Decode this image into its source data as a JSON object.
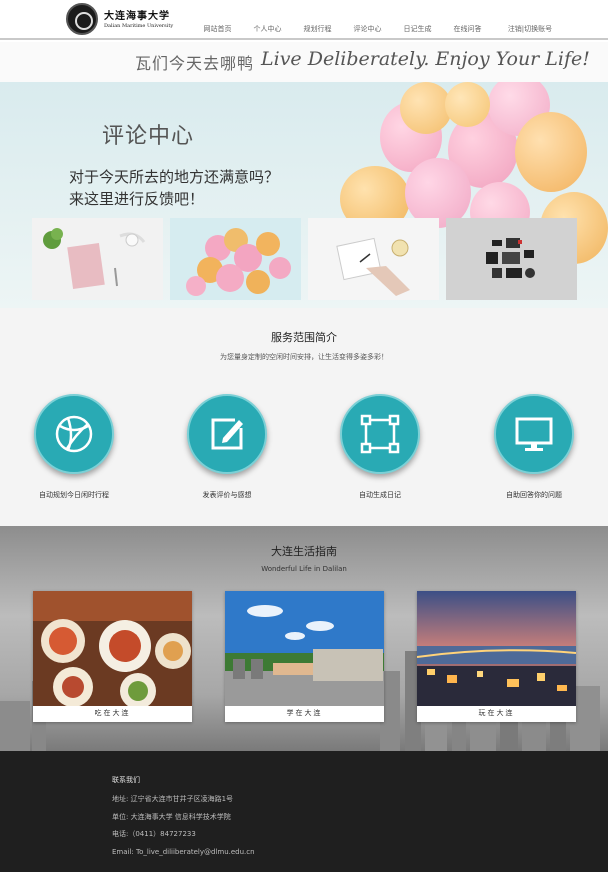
{
  "header": {
    "logo_cn": "大连海事大学",
    "logo_en": "Dalian Maritime University",
    "nav": [
      "网站首页",
      "个人中心",
      "规划行程",
      "评论中心",
      "日记生成",
      "在线问答",
      "注销|切换账号"
    ]
  },
  "slogan": {
    "cn": "瓦们今天去哪鸭",
    "en": "Live Deliberately. Enjoy Your Life!"
  },
  "hero": {
    "title": "评论中心",
    "subtitle_line1": "对于今天所去的地方还满意吗？",
    "subtitle_line2": "来这里进行反馈吧！"
  },
  "services": {
    "title": "服务范围简介",
    "subtitle": "为您量身定制的空闲时间安排，让生活变得多姿多彩！",
    "items": [
      {
        "label": "自动规划今日闲时行程",
        "icon": "basketball-icon"
      },
      {
        "label": "发表评价与感想",
        "icon": "edit-icon"
      },
      {
        "label": "自动生成日记",
        "icon": "frame-icon"
      },
      {
        "label": "自助回答你的问题",
        "icon": "monitor-icon"
      }
    ]
  },
  "guide": {
    "title": "大连生活指南",
    "subtitle": "Wonderful Life in Dalilan",
    "cards": [
      {
        "label": "吃在大连"
      },
      {
        "label": "学在大连"
      },
      {
        "label": "玩在大连"
      }
    ]
  },
  "footer": {
    "heading": "联系我们",
    "address": "地址: 辽宁省大连市甘井子区凌海路1号",
    "unit": "单位: 大连海事大学 信息科学技术学院",
    "phone": "电话:（0411）84727233",
    "email": "Email: To_live_diliiberately@dlmu.edu.cn"
  },
  "colors": {
    "accent": "#29aab4",
    "footer_bg": "#1f1f1f"
  }
}
